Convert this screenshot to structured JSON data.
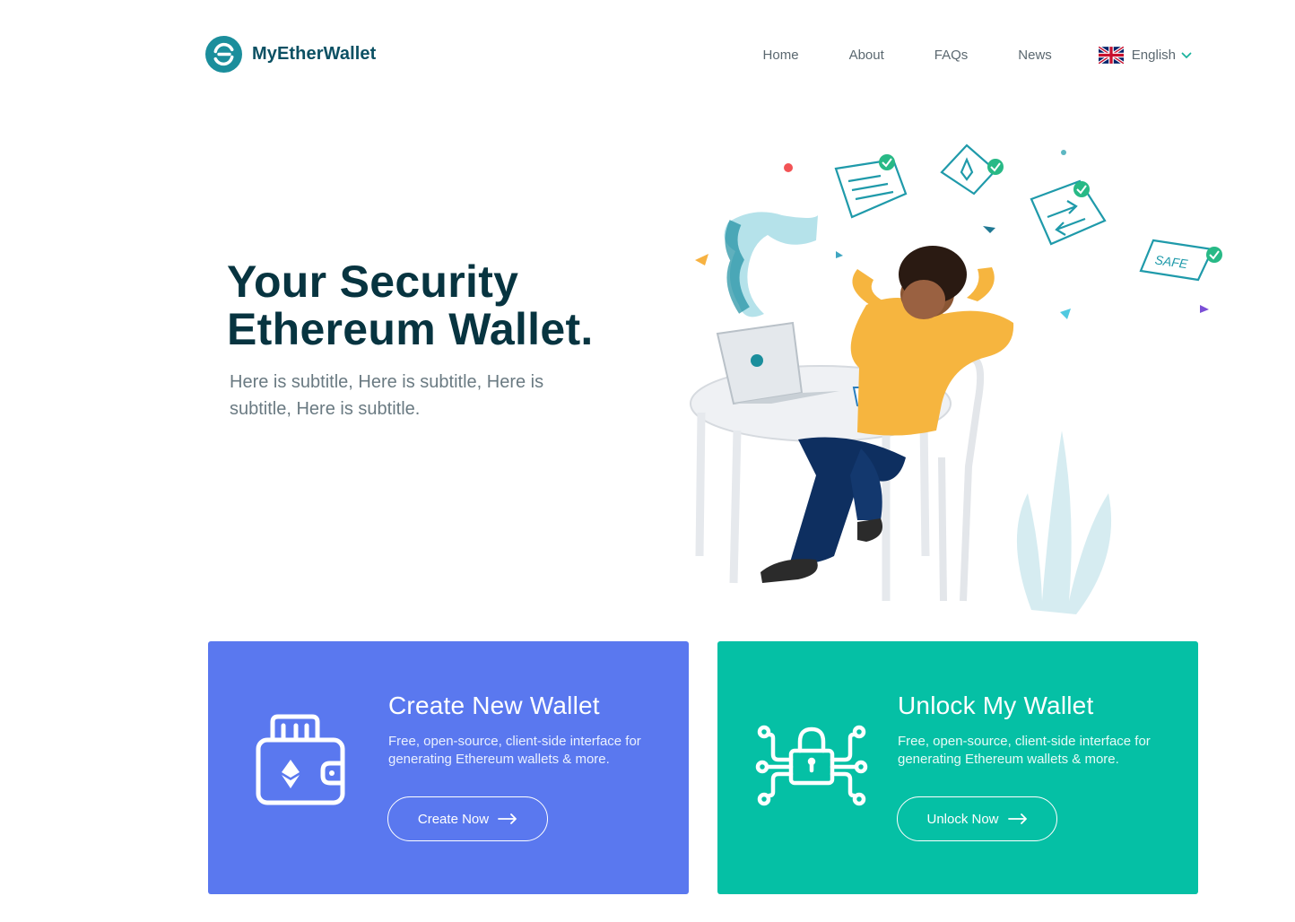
{
  "brand": {
    "name": "MyEtherWallet"
  },
  "nav": {
    "items": [
      {
        "label": "Home"
      },
      {
        "label": "About"
      },
      {
        "label": "FAQs"
      },
      {
        "label": "News"
      }
    ],
    "language": {
      "label": "English",
      "flag_icon": "uk-flag-icon"
    }
  },
  "hero": {
    "title_line1": "Your Security",
    "title_line2": "Ethereum Wallet.",
    "subtitle": "Here is subtitle, Here is subtitle, Here is subtitle, Here is subtitle."
  },
  "illustration": {
    "safe_label": "SAFE"
  },
  "cards": [
    {
      "title": "Create New Wallet",
      "description": "Free, open-source, client-side interface for generating Ethereum wallets & more.",
      "button_label": "Create Now",
      "icon": "wallet-ethereum-icon",
      "color": "#5a78ef"
    },
    {
      "title": "Unlock My Wallet",
      "description": "Free, open-source, client-side interface for generating Ethereum wallets & more.",
      "button_label": "Unlock Now",
      "icon": "circuit-lock-icon",
      "color": "#05c0a5"
    }
  ],
  "colors": {
    "brand_teal": "#1b9aaa",
    "heading": "#073440",
    "create_card": "#5a78ef",
    "unlock_card": "#05c0a5"
  }
}
